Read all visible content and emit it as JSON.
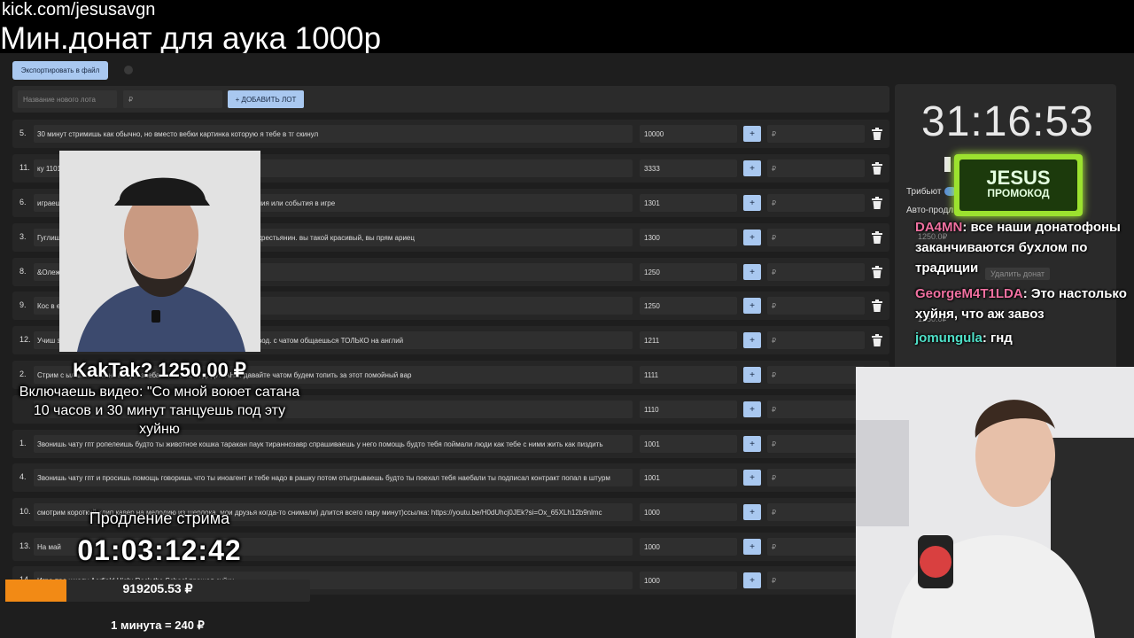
{
  "overlay": {
    "channel_url": "kick.com/jesusavgn",
    "min_donation": "Мин.донат для аука 1000р"
  },
  "toolbar": {
    "export_label": "Экспортировать в файл"
  },
  "add_lot": {
    "name_placeholder": "Название нового лота",
    "price_placeholder": "₽",
    "add_button": "+ ДОБАВИТЬ ЛОТ"
  },
  "lots": [
    {
      "num": "5.",
      "title": "30 минут стримишь как обычно, но вместо вебки картинка которую я тебе в тг скинул",
      "amount": "10000"
    },
    {
      "num": "11.",
      "title": "ку 1101",
      "amount": "3333"
    },
    {
      "num": "6.",
      "title": "играеш он твой компаньон читаешь донаты там тебе донатят задания или события в игре",
      "amount": "1301"
    },
    {
      "num": "3.",
      "title": "Гуглиш фотками говоришь. Господи, какой вы ариец, а я беззубый крестьянин. вы такой красивый, вы прям ариец",
      "amount": "1300"
    },
    {
      "num": "8.",
      "title": "&Олеж",
      "amount": "1250"
    },
    {
      "num": "9.",
      "title": "Кос в его стиле новости полчаса",
      "amount": "1250"
    },
    {
      "num": "12.",
      "title": "Учиш зуешь русский по минимуму, только если спрашиваешь перевод. с чатом общаешься ТОЛЬКО на англий",
      "amount": "1211"
    },
    {
      "num": "2.",
      "title": "Стрим с ылапает аминь нахуй. заебали. и. з. п. о. д. ДИВАНА. давайте чатом будем топить за этот помойный вар",
      "amount": "1111"
    },
    {
      "num": "",
      "title": "",
      "amount": "1110"
    },
    {
      "num": "1.",
      "title": "Звонишь чату гпт ропелеишь будто ты животное кошка таракан паук тираннозавр спрашиваешь у него помощь будто тебя поймали люди как тебе с ними жить как пиздить",
      "amount": "1001"
    },
    {
      "num": "4.",
      "title": "Звонишь чату гпт и просишь помощь говоришь что ты иноагент и тебе надо в рашку потом отыгрываешь будто ты поехал тебя наебали ты подписал контракт попал в штурм",
      "amount": "1001"
    },
    {
      "num": "10.",
      "title": "смотрим короткий клип кавер на мелодию из шерлока, мои друзья когда-то снимали) длится всего пару минут)ссылка: https://youtu.be/H0dUhcj0JEk?si=Ox_65XLh12b9nlmc",
      "amount": "1000"
    },
    {
      "num": "13.",
      "title": "На май",
      "amount": "1000"
    },
    {
      "num": "14.",
      "title": "Игра про школу Aerfield High: Rock the School прошел суйки",
      "amount": "1000"
    }
  ],
  "lot_add_placeholder": "₽",
  "lot_plus": "+",
  "timer_panel": {
    "time": "31:16:53",
    "tribute_label": "Трибьют",
    "autoprod_label": "Авто-продл"
  },
  "promo": {
    "name": "JESUS",
    "subtitle": "ПРОМОКОД"
  },
  "chat": [
    {
      "nick": "DA4MN",
      "text": ": все наши донатофоны заканчиваются бухлом по традиции"
    },
    {
      "nick": "GeorgeM4T1LDA",
      "text": ": Это настолько хуйня, что аж завоз"
    },
    {
      "nick": "jomungula",
      "text": ": гнд"
    }
  ],
  "ghost": {
    "amount_1": "1250.0₽",
    "delete_button": "Удалить донат",
    "amount_2": "1250.0₽",
    "donor_preview": "KakTak?: Включаешь видео: \"Со мной воюет сатана 10 часов и 30 минут танцуешь под эту хуйню"
  },
  "donation": {
    "donor": "KakTak?",
    "amount": "1250.00 ₽",
    "message": "Включаешь видео: \"Со мной воюет сатана 10 часов и 30 минут танцуешь под эту хуйню"
  },
  "extension": {
    "label": "Продление стрима",
    "time": "01:03:12:42"
  },
  "progress": {
    "amount": "919205.53 ₽",
    "fill_fraction": 0.2,
    "rate": "1 минута = 240 ₽"
  },
  "colors": {
    "accent": "#a9c8f0",
    "progress": "#f28a15",
    "promo": "#9ce22f"
  }
}
